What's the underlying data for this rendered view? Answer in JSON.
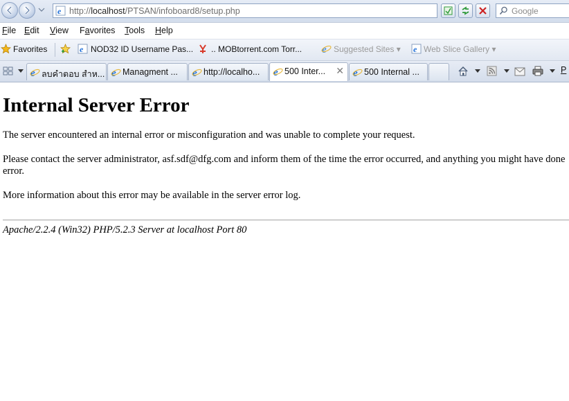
{
  "address_bar": {
    "url_prefix": "http://",
    "url_host": "localhost",
    "url_path": "/PTSAN/infoboard8/setup.php",
    "search_placeholder": "Google"
  },
  "menu": [
    {
      "label": "File",
      "key": "F"
    },
    {
      "label": "Edit",
      "key": "E"
    },
    {
      "label": "View",
      "key": "V"
    },
    {
      "label": "Favorites",
      "key": "a"
    },
    {
      "label": "Tools",
      "key": "T"
    },
    {
      "label": "Help",
      "key": "H"
    }
  ],
  "favorites_bar": {
    "favorites_label": "Favorites",
    "items": [
      {
        "label": "NOD32 ID Username Pas..."
      },
      {
        "label": ".. MOBtorrent.com  Torr..."
      },
      {
        "label": "Suggested Sites ▾"
      },
      {
        "label": "Web Slice Gallery ▾"
      }
    ]
  },
  "tabs": [
    {
      "label": "ลบคำตอบ สำห..."
    },
    {
      "label": "Managment ..."
    },
    {
      "label": "http://localho..."
    },
    {
      "label": "500 Inter...",
      "active": true
    },
    {
      "label": "500 Internal ..."
    }
  ],
  "page": {
    "title": "Internal Server Error",
    "paragraph1": "The server encountered an internal error or misconfiguration and was unable to complete your request.",
    "paragraph2_line1": "Please contact the server administrator, asf.sdf@dfg.com and inform them of the time the error occurred, and anything you might have done",
    "paragraph2_line2": "error.",
    "paragraph3": "More information about this error may be available in the server error log.",
    "server_signature": "Apache/2.2.4 (Win32) PHP/5.2.3 Server at localhost Port 80"
  },
  "colors": {
    "ie_blue": "#1e6fd9",
    "stop_red": "#cc2222",
    "refresh_green": "#2f9a3a"
  }
}
